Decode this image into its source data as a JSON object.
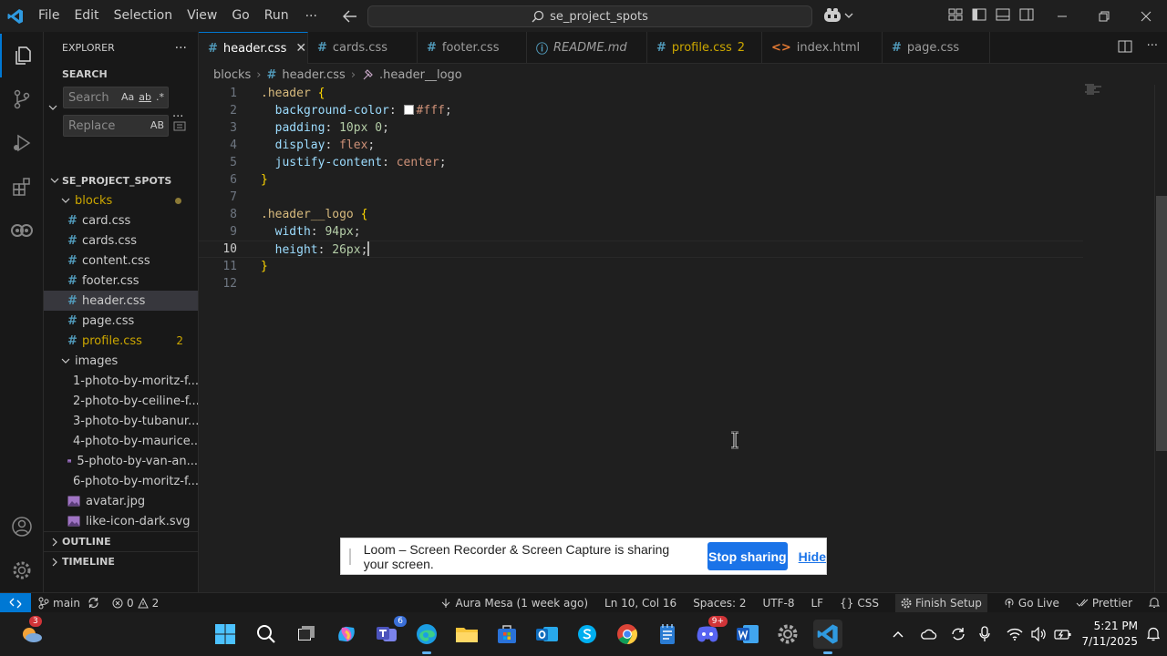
{
  "titlebar": {
    "menu": [
      "File",
      "Edit",
      "Selection",
      "View",
      "Go",
      "Run"
    ],
    "more": "···",
    "command_center": "se_project_spots"
  },
  "sidebar": {
    "title": "EXPLORER",
    "more": "···",
    "search_section": "SEARCH",
    "search_placeholder": "Search",
    "replace_placeholder": "Replace",
    "search_opts": [
      "Aa",
      "ab",
      ".*"
    ],
    "replace_opt": "AB",
    "project": "SE_PROJECT_SPOTS",
    "folder_blocks": "blocks",
    "files": [
      {
        "name": "card.css"
      },
      {
        "name": "cards.css"
      },
      {
        "name": "content.css"
      },
      {
        "name": "footer.css"
      },
      {
        "name": "header.css"
      },
      {
        "name": "page.css"
      },
      {
        "name": "profile.css",
        "problems": "2"
      }
    ],
    "folder_images": "images",
    "images": [
      "1-photo-by-moritz-f...",
      "2-photo-by-ceiline-f...",
      "3-photo-by-tubanur...",
      "4-photo-by-maurice...",
      "5-photo-by-van-an...",
      "6-photo-by-moritz-f...",
      "avatar.jpg",
      "like-icon-dark.svg"
    ],
    "outline": "OUTLINE",
    "timeline": "TIMELINE"
  },
  "tabs": [
    {
      "label": "header.css"
    },
    {
      "label": "cards.css"
    },
    {
      "label": "footer.css"
    },
    {
      "label": "README.md"
    },
    {
      "label": "profile.css",
      "count": "2"
    },
    {
      "label": "index.html"
    },
    {
      "label": "page.css"
    }
  ],
  "breadcrumb": [
    "blocks",
    "header.css",
    ".header__logo"
  ],
  "editor": {
    "line_numbers": [
      "1",
      "2",
      "3",
      "4",
      "5",
      "6",
      "7",
      "8",
      "9",
      "10",
      "11",
      "12"
    ],
    "current_line": "10",
    "code": {
      "l1_sel": ".header",
      "l2_prop": "background-color",
      "l2_val": "#fff",
      "l3_prop": "padding",
      "l3_val": "10px 0",
      "l4_prop": "display",
      "l4_val": "flex",
      "l5_prop": "justify-content",
      "l5_val": "center",
      "l8_sel": ".header__logo",
      "l9_prop": "width",
      "l9_val": "94px",
      "l10_prop": "height",
      "l10_val": "26px"
    }
  },
  "banner": {
    "text": "Loom – Screen Recorder & Screen Capture is sharing your screen.",
    "stop": "Stop sharing",
    "hide": "Hide"
  },
  "statusbar": {
    "branch": "main",
    "errors": "0",
    "warnings": "2",
    "blame": "Aura Mesa (1 week ago)",
    "position": "Ln 10, Col 16",
    "spaces": "Spaces: 2",
    "encoding": "UTF-8",
    "eol": "LF",
    "language": "CSS",
    "finish_setup": "Finish Setup",
    "go_live": "Go Live",
    "prettier": "Prettier"
  },
  "taskbar": {
    "weather_badge": "3",
    "teams_badge": "6",
    "discord_badge": "9+",
    "time": "5:21 PM",
    "date": "7/11/2025"
  }
}
